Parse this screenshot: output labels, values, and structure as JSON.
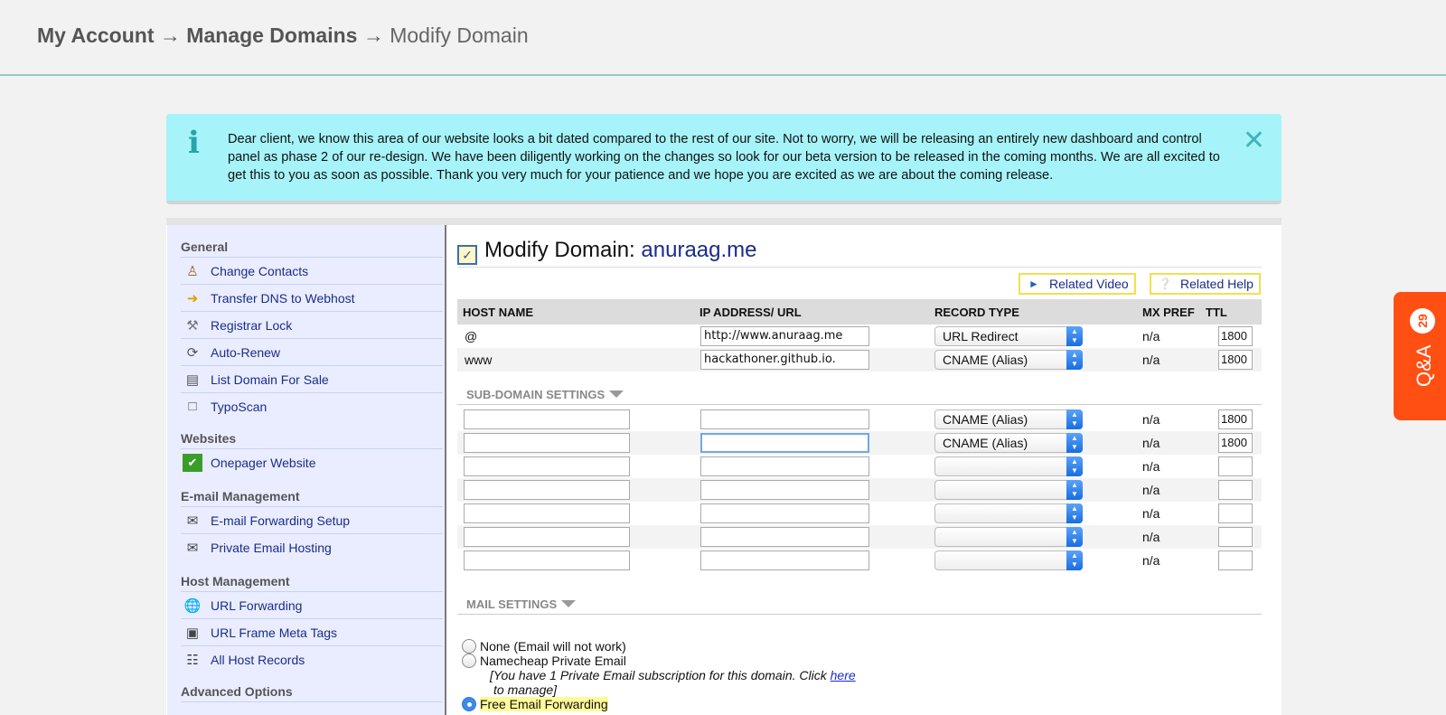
{
  "breadcrumb": {
    "level1": "My Account",
    "level2": "Manage Domains",
    "current": "Modify Domain",
    "sep1": "→",
    "sep2": "→"
  },
  "notice": {
    "icon": "i",
    "message": "Dear client, we know this area of our website looks a bit dated compared to the rest of our site. Not to worry, we will be releasing an entirely new dashboard and control panel as phase 2 of our re-design. We have been diligently working on the changes so look for our beta version to be released in the coming months. We are all excited to get this to you as soon as possible. Thank you very much for your patience and we hope you are excited as we are about the coming release.",
    "close": "✕"
  },
  "sidebar": {
    "sections": [
      {
        "title": "General",
        "items": [
          {
            "label": "Change Contacts",
            "icon": "contacts-icon"
          },
          {
            "label": "Transfer DNS to Webhost",
            "icon": "arrow-icon"
          },
          {
            "label": "Registrar Lock",
            "icon": "lock-icon"
          },
          {
            "label": "Auto-Renew",
            "icon": "renew-icon"
          },
          {
            "label": "List Domain For Sale",
            "icon": "list-icon"
          },
          {
            "label": "TypoScan",
            "icon": "typoscan-icon"
          }
        ]
      },
      {
        "title": "Websites",
        "items": [
          {
            "label": "Onepager Website",
            "icon": "check-icon"
          }
        ]
      },
      {
        "title": "E-mail Management",
        "items": [
          {
            "label": "E-mail Forwarding Setup",
            "icon": "email-forward-icon"
          },
          {
            "label": "Private Email Hosting",
            "icon": "email-icon"
          }
        ]
      },
      {
        "title": "Host Management",
        "items": [
          {
            "label": "URL Forwarding",
            "icon": "globe-icon"
          },
          {
            "label": "URL Frame Meta Tags",
            "icon": "frame-icon"
          },
          {
            "label": "All Host Records",
            "icon": "records-icon"
          }
        ]
      },
      {
        "title": "Advanced Options",
        "items": []
      }
    ]
  },
  "main": {
    "title": "Modify Domain:",
    "domain": "anuraag.me",
    "related_video": "Related Video",
    "related_help": "Related Help",
    "columns": [
      "HOST NAME",
      "IP ADDRESS/ URL",
      "RECORD TYPE",
      "MX PREF",
      "TTL"
    ],
    "records": [
      {
        "host": "@",
        "value": "http://www.anuraag.me",
        "type": "URL Redirect",
        "mx": "n/a",
        "ttl": "1800"
      },
      {
        "host": "www",
        "value": "hackathoner.github.io.",
        "type": "CNAME (Alias)",
        "mx": "n/a",
        "ttl": "1800"
      }
    ],
    "subdomain_title": "SUB-DOMAIN SETTINGS",
    "subdomain_rows": [
      {
        "host": "",
        "value": "",
        "type": "CNAME (Alias)",
        "mx": "n/a",
        "ttl": "1800"
      },
      {
        "host": "",
        "value": "",
        "type": "CNAME (Alias)",
        "mx": "n/a",
        "ttl": "1800"
      },
      {
        "host": "",
        "value": "",
        "type": "",
        "mx": "n/a",
        "ttl": ""
      },
      {
        "host": "",
        "value": "",
        "type": "",
        "mx": "n/a",
        "ttl": ""
      },
      {
        "host": "",
        "value": "",
        "type": "",
        "mx": "n/a",
        "ttl": ""
      },
      {
        "host": "",
        "value": "",
        "type": "",
        "mx": "n/a",
        "ttl": ""
      },
      {
        "host": "",
        "value": "",
        "type": "",
        "mx": "n/a",
        "ttl": ""
      }
    ],
    "mail_title": "MAIL SETTINGS",
    "mail_options": [
      {
        "label": "None (Email will not work)",
        "selected": false
      },
      {
        "label": "Namecheap Private Email",
        "selected": false
      },
      {
        "label": "Free Email Forwarding",
        "selected": true
      }
    ],
    "private_email_note_line1": "[You have 1 Private Email subscription for this domain. Click",
    "private_email_note_link": "here",
    "private_email_note_line2": "to manage]"
  },
  "qa_widget": {
    "label": "Q&A",
    "count": "29"
  }
}
